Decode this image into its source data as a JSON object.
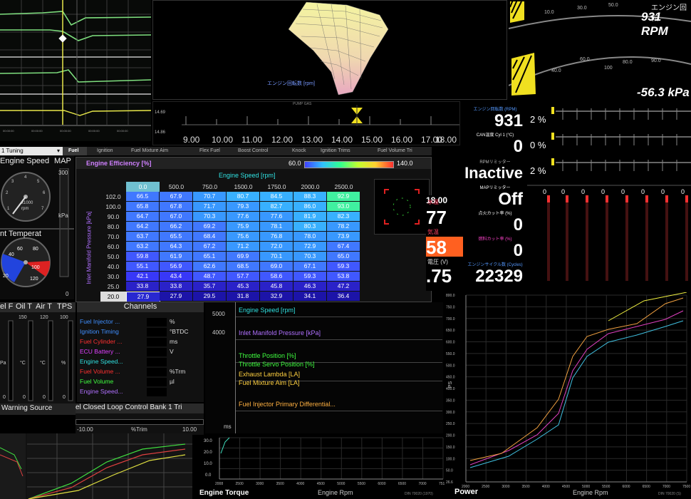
{
  "scope": {
    "colors": {
      "trace": "#7fe07f",
      "cursor": "#e8e84a"
    }
  },
  "plot3d": {
    "label": "エンジン回転数 [rpm]"
  },
  "gauges": {
    "top_label": "エンジン回転",
    "rpm": "931 RPM",
    "kpa": "-56.3 kPa",
    "ticks": [
      "10.0",
      "20.0",
      "30.0",
      "40.0",
      "50.0",
      "60.0",
      "70.0",
      "80.0",
      "90.0",
      "100"
    ]
  },
  "ruler": {
    "title": "PUMP GAS",
    "left_vals": [
      "14.69",
      "14.86"
    ],
    "ticks": [
      "9.00",
      "10.00",
      "11.00",
      "12.00",
      "13.00",
      "14.00",
      "15.00",
      "16.00",
      "17.00",
      "18.00"
    ]
  },
  "readouts": [
    {
      "label": "エンジン回転数 (RPM)",
      "value": "931",
      "label_color": "#5599ff"
    },
    {
      "label": "CAN温度 Cyl 1 (°C)",
      "value": "0",
      "label_color": "#ffffff"
    },
    {
      "label": "RPMリミッター",
      "value": "Inactive",
      "label_color": "#bbbbbb"
    },
    {
      "label": "MAPリミッター",
      "value": "Off",
      "label_color": "#ffffff"
    },
    {
      "label": "点火カット率 (%)",
      "value": "0",
      "label_color": "#ffffff"
    },
    {
      "label": "燃料カット率 (%)",
      "value": "0",
      "label_color": "#ff44cc"
    },
    {
      "label": "エンジンサイクル数 (Cycles)",
      "value": "22329",
      "label_color": "#5599ff"
    }
  ],
  "bars": {
    "pct1": "2 %",
    "pct2": "0 %",
    "pct3": "2 %",
    "zeros": [
      "0",
      "0",
      "0",
      "0",
      "0",
      "0",
      "0",
      "0"
    ]
  },
  "big_readouts": {
    "v1": "77",
    "l1": "水温",
    "v2": "58",
    "l2": "気温",
    "v3": ".75",
    "l3": "電圧 (V)",
    "v0": "18.00"
  },
  "small_gauges": {
    "select": "1 Tuning",
    "engine_speed": "Engine Speed",
    "map": "MAP",
    "map_unit": "kPa",
    "map_max": "300",
    "map_zero": "0",
    "rpm_x": "x1000",
    "rpm_unit": "rpm",
    "rpm_ticks": [
      "1",
      "2",
      "3",
      "4",
      "5",
      "6",
      "7"
    ],
    "temp": "nt Temperat",
    "temp_ticks": [
      "20",
      "40",
      "60",
      "80",
      "100",
      "120"
    ]
  },
  "tabs": [
    "Fuel",
    "Ignition",
    "Fuel Mixture Aim",
    "Flex Fuel",
    "Boost Control",
    "Knock",
    "Ignition Trims",
    "Fuel Volume Tri"
  ],
  "fuel_table": {
    "title": "Engine Efficiency [%]",
    "scale_min": "60.0",
    "scale_max": "140.0",
    "x_title": "Engine Speed [rpm]",
    "y_title": "Inlet Manifold Pressure [kPa]",
    "cols": [
      "0.0",
      "500.0",
      "750.0",
      "1500.0",
      "1750.0",
      "2000.0",
      "2500.0"
    ],
    "rows": [
      {
        "y": "102.0",
        "v": [
          "66.5",
          "67.9",
          "70.7",
          "80.7",
          "84.5",
          "88.3",
          "92.9"
        ]
      },
      {
        "y": "100.0",
        "v": [
          "65.8",
          "67.8",
          "71.7",
          "79.3",
          "82.7",
          "86.0",
          "93.0"
        ]
      },
      {
        "y": "90.0",
        "v": [
          "64.7",
          "67.0",
          "70.3",
          "77.6",
          "77.6",
          "81.9",
          "82.3"
        ]
      },
      {
        "y": "80.0",
        "v": [
          "64.2",
          "66.2",
          "69.2",
          "75.9",
          "78.1",
          "80.3",
          "78.2"
        ]
      },
      {
        "y": "70.0",
        "v": [
          "63.7",
          "65.5",
          "68.4",
          "75.6",
          "76.8",
          "78.0",
          "73.9"
        ]
      },
      {
        "y": "60.0",
        "v": [
          "63.2",
          "64.3",
          "67.2",
          "71.2",
          "72.0",
          "72.9",
          "67.4"
        ]
      },
      {
        "y": "50.0",
        "v": [
          "59.8",
          "61.9",
          "65.1",
          "69.9",
          "70.1",
          "70.3",
          "65.0"
        ]
      },
      {
        "y": "40.0",
        "v": [
          "55.1",
          "56.9",
          "62.6",
          "68.5",
          "69.0",
          "67.1",
          "59.3"
        ]
      },
      {
        "y": "30.0",
        "v": [
          "42.1",
          "43.4",
          "48.7",
          "57.7",
          "58.6",
          "59.3",
          "53.8"
        ]
      },
      {
        "y": "25.0",
        "v": [
          "33.8",
          "33.8",
          "35.7",
          "45.3",
          "45.8",
          "46.3",
          "47.2"
        ]
      },
      {
        "y": "20.0",
        "v": [
          "27.9",
          "27.9",
          "29.5",
          "31.8",
          "32.9",
          "34.1",
          "36.4"
        ]
      }
    ]
  },
  "bar_gauges": {
    "headers": [
      "el F",
      "Oil T",
      "Air T",
      "TPS"
    ],
    "maxes": [
      "150",
      "120",
      "100"
    ],
    "units": [
      "Pa",
      "°C",
      "°C",
      "%"
    ],
    "zeros": [
      "0",
      "0",
      "0",
      "0"
    ]
  },
  "channels": {
    "title": "Channels",
    "items": [
      {
        "name": "Fuel Injector ...",
        "unit": "%",
        "color": "#3f8fff"
      },
      {
        "name": "Ignition Timing",
        "unit": "°BTDC",
        "color": "#3f8fff"
      },
      {
        "name": "Fuel Cylinder ...",
        "unit": "ms",
        "color": "#ff3030"
      },
      {
        "name": "ECU Battery ...",
        "unit": "V",
        "color": "#e040ff"
      },
      {
        "name": "Engine Speed...",
        "unit": "",
        "color": "#30e0e0"
      },
      {
        "name": "Fuel Volume ...",
        "unit": "%Trm",
        "color": "#ff3030"
      },
      {
        "name": "Fuel Volume",
        "unit": "µl",
        "color": "#40ff40"
      },
      {
        "name": "Engine Speed...",
        "unit": "",
        "color": "#b070ff"
      }
    ]
  },
  "warning": "Warning Source",
  "closed_loop": {
    "title": "el Closed Loop Control Bank 1 Tri",
    "min": "-10.00",
    "unit": "%Trim",
    "max": "10.00"
  },
  "logger": {
    "y_top": "5000",
    "y_mid": "4000",
    "y_unit": "ms",
    "rows": [
      {
        "t": "Engine Speed [rpm]",
        "c": "#30e0e0"
      },
      {
        "t": "Inlet Manifold Pressure [kPa]",
        "c": "#b070ff"
      },
      {
        "t": "Throttle Position [%]",
        "c": "#40ff40"
      },
      {
        "t": "Throttle Servo Position [%]",
        "c": "#40ff40"
      },
      {
        "t": "Exhaust Lambda [LA]",
        "c": "#ffd040"
      },
      {
        "t": "Fuel Mixture Aim [LA]",
        "c": "#ffd040"
      },
      {
        "t": "Fuel Injector Primary Differential...",
        "c": "#ffb040"
      }
    ]
  },
  "dyno": {
    "title": "Power",
    "xlabel": "Engine Rpm",
    "ylabel": "PS",
    "corner": "DIN 70020 (S)",
    "yticks": [
      "800.0",
      "750.0",
      "700.0",
      "650.0",
      "600.0",
      "550.0",
      "500.0",
      "450.0",
      "400.0",
      "350.0",
      "300.0",
      "250.0",
      "200.0",
      "150.0",
      "100.0",
      "50.0",
      "26.6"
    ],
    "xticks": [
      "2000",
      "2500",
      "3000",
      "3500",
      "4000",
      "4500",
      "5000",
      "5500",
      "6000",
      "6500",
      "7000",
      "7500"
    ]
  },
  "torque": {
    "title": "Engine Torque",
    "xlabel": "Engine Rpm",
    "corner": "DIN 70020 (1970)",
    "ytop": "30.0",
    "ymid": "20.0",
    "ylow": "10.0",
    "yzero": "0.0",
    "xticks": [
      "2008",
      "2500",
      "3000",
      "3500",
      "4000",
      "4500",
      "5000",
      "5500",
      "6000",
      "6500",
      "7000",
      "7518"
    ]
  }
}
